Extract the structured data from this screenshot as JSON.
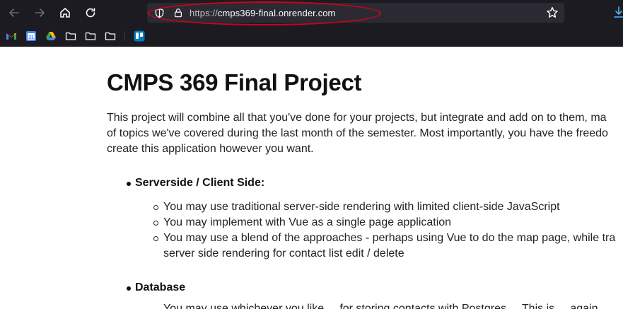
{
  "browser": {
    "url_scheme": "https://",
    "url_host": "cmps369-final.onrender.com",
    "icons": [
      "back-icon",
      "forward-icon",
      "home-icon",
      "reload-icon",
      "shield-icon",
      "lock-icon",
      "star-icon",
      "download-icon"
    ]
  },
  "bookmarks": [
    "gmail-icon",
    "calendar-icon",
    "drive-icon",
    "folder-icon",
    "folder-icon",
    "folder-icon",
    "trello-icon"
  ],
  "calendar_day": "31",
  "page": {
    "title": "CMPS 369 Final Project",
    "intro_lines": [
      "This project will combine all that you've done for your projects, but integrate and add on to them, ma",
      "of topics we've covered during the last month of the semester. Most importantly, you have the freedo",
      "create this application however you want."
    ],
    "section1": "Serverside / Client Side:",
    "section1_items": [
      "You may use traditional server-side rendering with limited client-side JavaScript",
      "You may implement with Vue as a single page application",
      "You may use a blend of the approaches - perhaps using Vue to do the map page, while tra"
    ],
    "section1_item3_cont": "server side rendering for contact list edit / delete",
    "section2": "Database",
    "section2_peek": "You may use whichever you like ... for storing contacts with Postgres ... This is ... again"
  }
}
